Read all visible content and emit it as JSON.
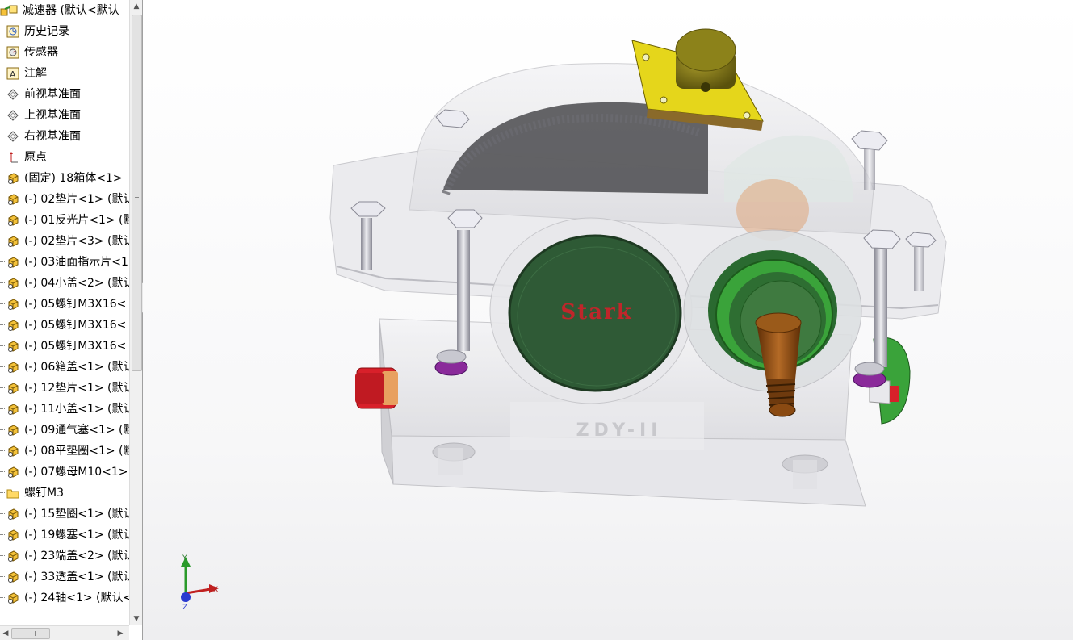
{
  "feature_tree": {
    "root_label": "减速器 (默认<默认",
    "items": [
      {
        "icon": "history-icon",
        "label": "历史记录"
      },
      {
        "icon": "sensor-icon",
        "label": "传感器"
      },
      {
        "icon": "annotation-icon",
        "label": "注解"
      },
      {
        "icon": "plane-icon",
        "label": "前视基准面"
      },
      {
        "icon": "plane-icon",
        "label": "上视基准面"
      },
      {
        "icon": "plane-icon",
        "label": "右视基准面"
      },
      {
        "icon": "origin-icon",
        "label": "原点"
      },
      {
        "icon": "part-icon",
        "label": "(固定) 18箱体<1>"
      },
      {
        "icon": "part-icon",
        "label": "(-) 02垫片<1> (默认"
      },
      {
        "icon": "part-icon",
        "label": "(-) 01反光片<1> (默"
      },
      {
        "icon": "part-icon",
        "label": "(-) 02垫片<3> (默认"
      },
      {
        "icon": "part-icon",
        "label": "(-) 03油面指示片<1"
      },
      {
        "icon": "part-icon",
        "label": "(-) 04小盖<2> (默认"
      },
      {
        "icon": "part-icon",
        "label": "(-) 05螺钉M3X16<"
      },
      {
        "icon": "part-icon",
        "label": "(-) 05螺钉M3X16<"
      },
      {
        "icon": "part-icon",
        "label": "(-) 05螺钉M3X16<"
      },
      {
        "icon": "part-icon",
        "label": "(-) 06箱盖<1> (默认"
      },
      {
        "icon": "part-icon",
        "label": "(-) 12垫片<1> (默认"
      },
      {
        "icon": "part-icon",
        "label": "(-) 11小盖<1> (默认"
      },
      {
        "icon": "part-icon",
        "label": "(-) 09通气塞<1> (默"
      },
      {
        "icon": "part-icon",
        "label": "(-) 08平垫圈<1> (默"
      },
      {
        "icon": "part-icon",
        "label": "(-) 07螺母M10<1>"
      },
      {
        "icon": "folder-icon",
        "label": "螺钉M3"
      },
      {
        "icon": "part-icon",
        "label": "(-) 15垫圈<1> (默认"
      },
      {
        "icon": "part-icon",
        "label": "(-) 19螺塞<1> (默认"
      },
      {
        "icon": "part-icon",
        "label": "(-) 23端盖<2> (默认"
      },
      {
        "icon": "part-icon",
        "label": "(-) 33透盖<1> (默认"
      },
      {
        "icon": "part-icon",
        "label": "(-) 24轴<1> (默认<"
      }
    ]
  },
  "model": {
    "end_cap_text": "Stark",
    "case_marking": "ZDY-II",
    "colors": {
      "cover_green": "#2f5a36",
      "bearing_green": "#3aa33a",
      "shaft_brown": "#8a4a12",
      "breather_yellow": "#e0d21a",
      "plug_red": "#d8202a",
      "housing": "#d9d9dc"
    }
  },
  "triad": {
    "x": "X",
    "y": "Y",
    "z": "Z"
  },
  "icons": {
    "expand_left": "chevron-left-icon",
    "scroll_up": "arrow-up-icon",
    "scroll_down": "arrow-down-icon",
    "scroll_left": "arrow-left-icon",
    "scroll_right": "arrow-right-icon"
  }
}
